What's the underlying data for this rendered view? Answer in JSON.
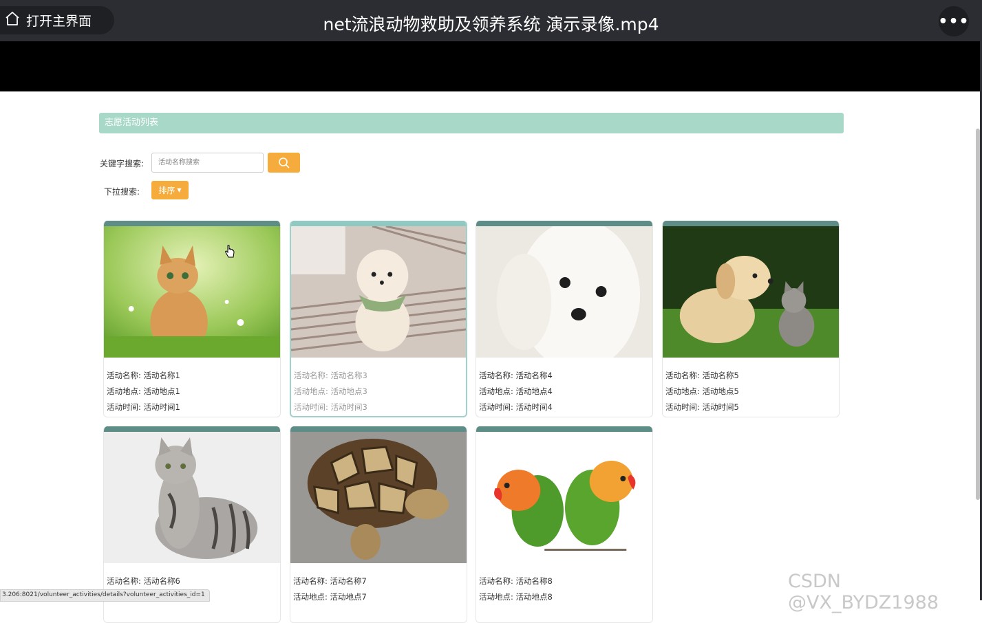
{
  "player": {
    "home_label": "打开主界面",
    "title": "net流浪动物救助及领养系统 演示录像.mp4",
    "more_label": "•••"
  },
  "page": {
    "section_title": "志愿活动列表",
    "keyword_label": "关键字搜索:",
    "search_placeholder": "活动名称搜索",
    "dropdown_label": "下拉搜索:",
    "sort_label": "排序"
  },
  "cards": [
    {
      "name": "活动名称: 活动名称1",
      "place": "活动地点: 活动地点1",
      "time": "活动时间: 活动时间1"
    },
    {
      "name": "活动名称: 活动名称3",
      "place": "活动地点: 活动地点3",
      "time": "活动时间: 活动时间3"
    },
    {
      "name": "活动名称: 活动名称4",
      "place": "活动地点: 活动地点4",
      "time": "活动时间: 活动时间4"
    },
    {
      "name": "活动名称: 活动名称5",
      "place": "活动地点: 活动地点5",
      "time": "活动时间: 活动时间5"
    },
    {
      "name": "活动名称: 活动名称6",
      "place": "",
      "time": ""
    },
    {
      "name": "活动名称: 活动名称7",
      "place": "活动地点: 活动地点7",
      "time": ""
    },
    {
      "name": "活动名称: 活动名称8",
      "place": "活动地点: 活动地点8",
      "time": ""
    }
  ],
  "status_url": "3.206:8021/volunteer_activities/details?volunteer_activities_id=1",
  "watermark": "CSDN @VX_BYDZ1988"
}
